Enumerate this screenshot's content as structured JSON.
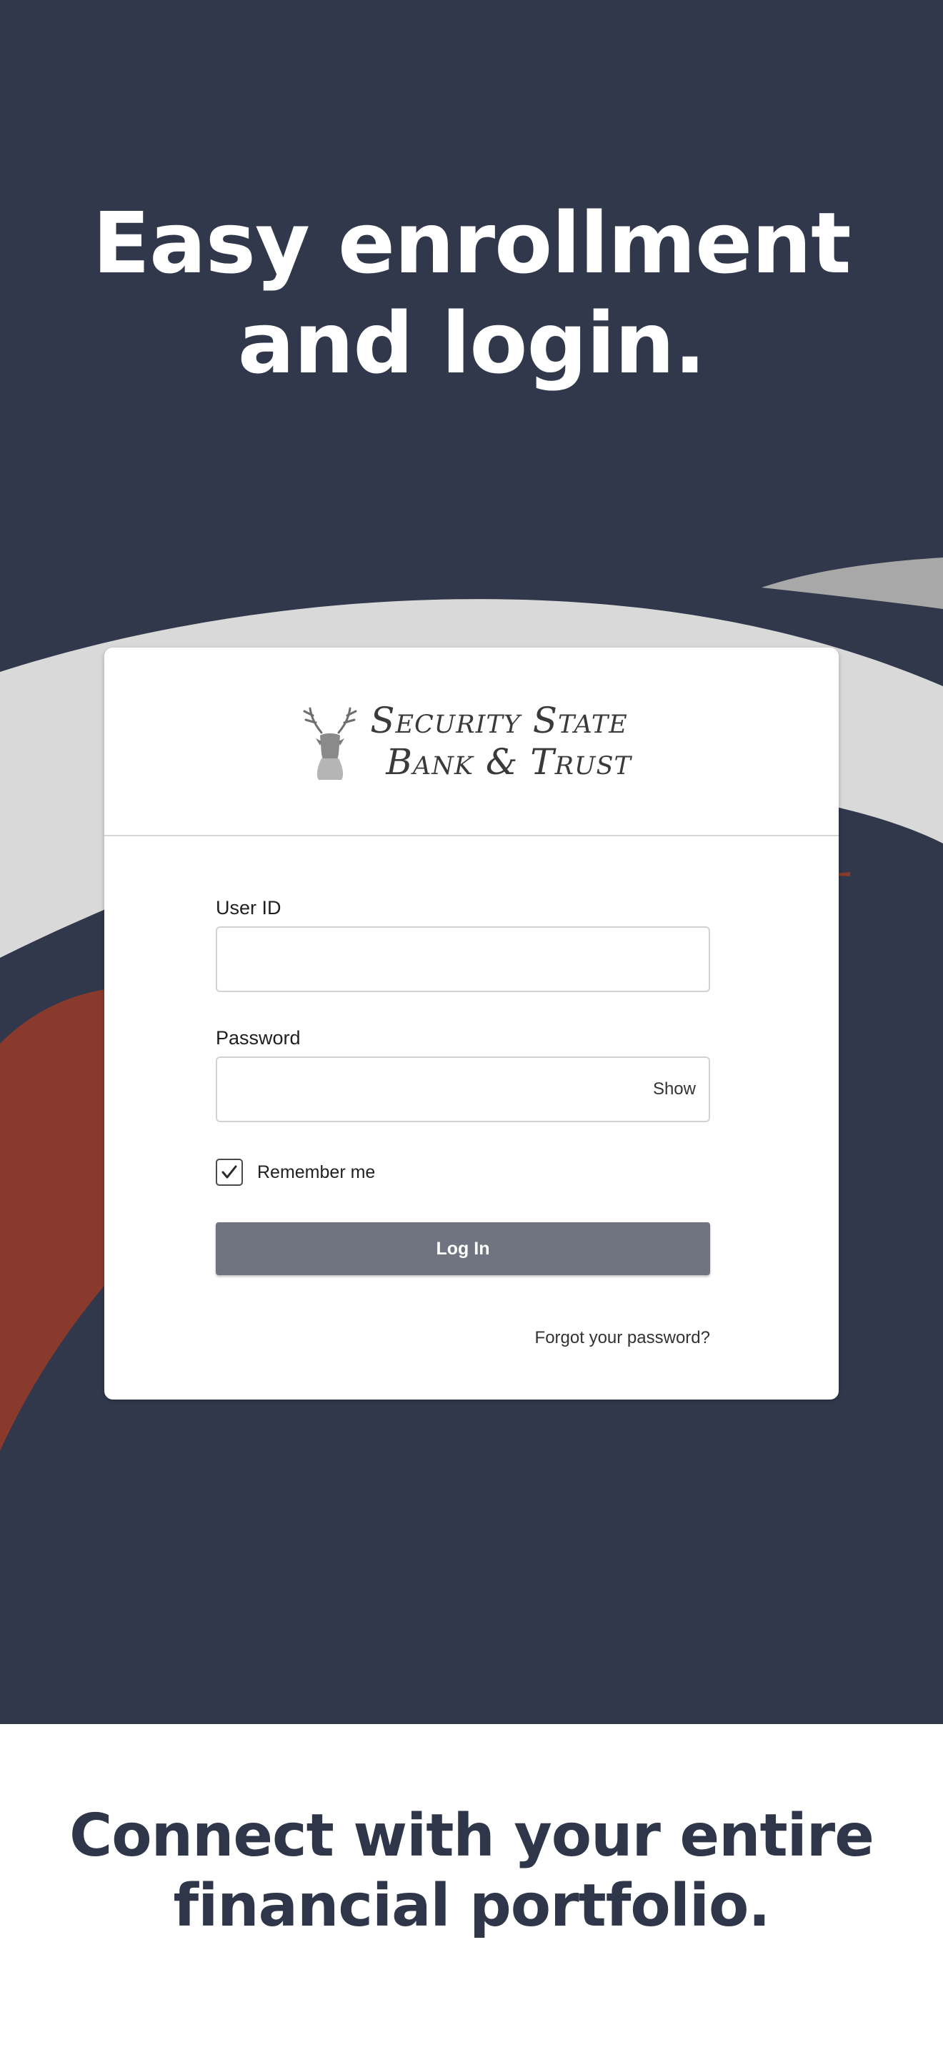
{
  "hero": {
    "headline_line1": "Easy enrollment",
    "headline_line2": "and login."
  },
  "card": {
    "logo": {
      "line1": "Security State",
      "line2": "Bank & Trust",
      "icon": "deer-head-icon"
    },
    "user_id_label": "User ID",
    "user_id_value": "",
    "password_label": "Password",
    "password_value": "",
    "show_label": "Show",
    "remember_label": "Remember me",
    "remember_checked": true,
    "login_label": "Log In",
    "forgot_label": "Forgot your password?"
  },
  "footer": {
    "line1": "Connect with your entire",
    "line2": "financial portfolio."
  },
  "colors": {
    "background_navy": "#31384b",
    "swoosh_light": "#d9d9d9",
    "swoosh_gray": "#a8a8a8",
    "swoosh_rust": "#8a3a2c",
    "button_gray": "#6f7480",
    "footer_text": "#2f3649"
  }
}
